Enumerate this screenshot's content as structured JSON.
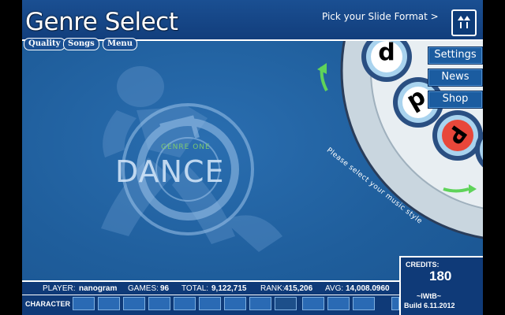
{
  "header": {
    "title": "Genre Select",
    "slide_format": "Pick your Slide Format >"
  },
  "menu": [
    "Quality",
    "Songs",
    "Menu"
  ],
  "side_buttons": [
    "Settings",
    "News",
    "Shop"
  ],
  "wheel": {
    "instruction": "Please select your music style"
  },
  "genre": {
    "label": "GENRE ONE",
    "name": "DANCE"
  },
  "stats": {
    "player_label": "PLAYER:",
    "player": "nanogram",
    "games_label": "GAMES:",
    "games": "96",
    "total_label": "TOTAL:",
    "total": "9,122,715",
    "rank_label": "RANK:",
    "rank": "415,206",
    "avg_label": "AVG:",
    "avg": "14,008.0960"
  },
  "credits": {
    "label": "CREDITS:",
    "value": "180",
    "brand": "~IWtB~",
    "build": "Build 6.11.2012"
  },
  "character": {
    "label": "CHARACTER"
  },
  "colors": {
    "background": "#1f5e9c",
    "panel": "#0f3a78",
    "genre_label": "#7cc870",
    "selected_disc": "#e8473a"
  }
}
